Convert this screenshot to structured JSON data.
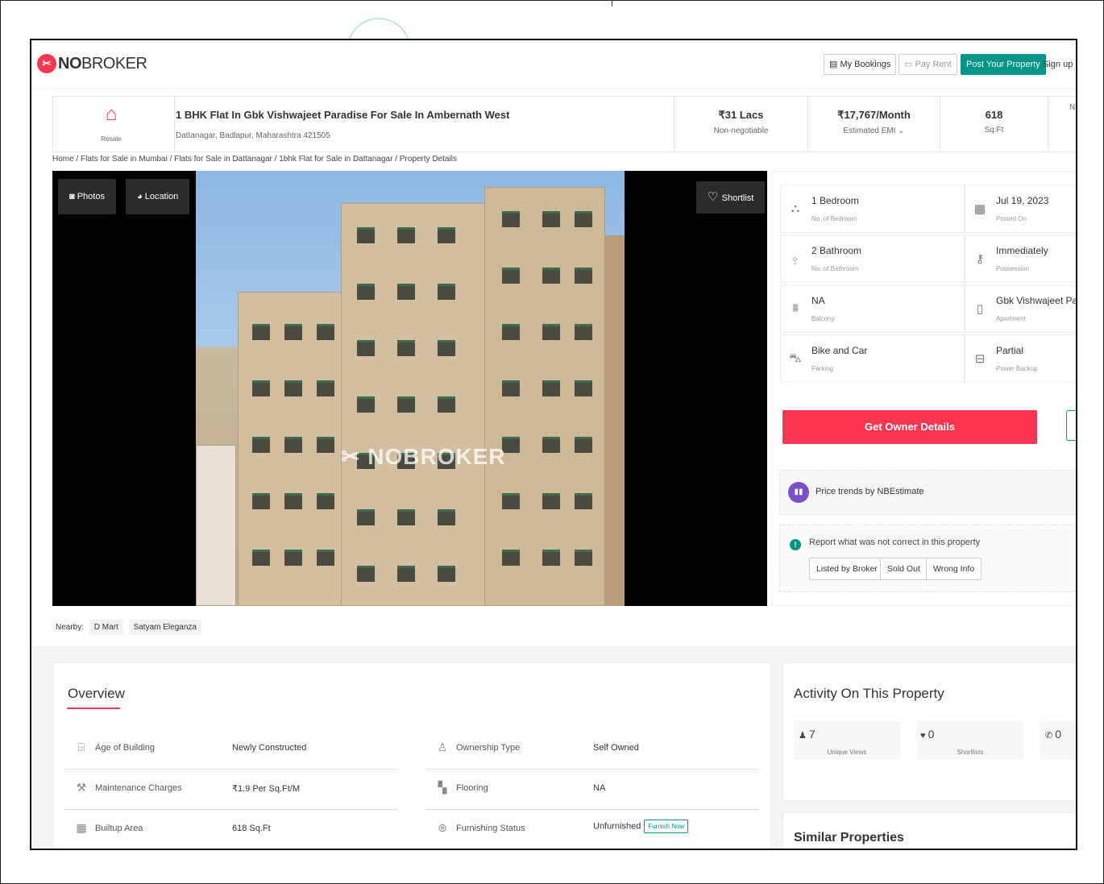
{
  "brand": {
    "logo_text_bold": "NO",
    "logo_text_rest": "BROKER",
    "accent": "#fd3752",
    "green": "#009587"
  },
  "header": {
    "my_bookings": "My Bookings",
    "pay_rent": "Pay Rent",
    "post_property": "Post Your Property",
    "sign_up": "Sign up"
  },
  "listing": {
    "badge": "Resale",
    "title": "1 BHK Flat In Gbk Vishwajeet Paradise For Sale In Ambernath West",
    "address": "Dattanagar, Badlapur, Maharashtra 421505",
    "price": "₹31 Lacs",
    "price_note": "Non-negotiable",
    "emi": "₹17,767/Month",
    "emi_note": "Estimated EMI",
    "area": "618",
    "area_unit": "Sq.Ft",
    "cut_letter": "N"
  },
  "breadcrumb": "Home / Flats for Sale in Mumbai / Flats for Sale in Dattanagar / 1bhk Flat for Sale in Dattanagar / Property Details",
  "photo": {
    "photos_label": "Photos",
    "location_label": "Location",
    "shortlist_label": "Shortlist",
    "watermark": "NOBROKER"
  },
  "nearby": {
    "label": "Nearby:",
    "items": [
      "D Mart",
      "Satyam Eleganza"
    ]
  },
  "details": [
    {
      "value": "1 Bedroom",
      "label": "No. of Bedroom",
      "icon": "bed-icon"
    },
    {
      "value": "Jul 19, 2023",
      "label": "Posted On",
      "icon": "calendar-icon"
    },
    {
      "value": "2 Bathroom",
      "label": "No. of Bathroom",
      "icon": "bath-icon"
    },
    {
      "value": "Immediately",
      "label": "Possession",
      "icon": "key-icon"
    },
    {
      "value": "NA",
      "label": "Balcony",
      "icon": "balcony-icon"
    },
    {
      "value": "Gbk Vishwajeet Par...",
      "label": "Apartment",
      "icon": "building-icon"
    },
    {
      "value": "Bike and Car",
      "label": "Parking",
      "icon": "car-icon"
    },
    {
      "value": "Partial",
      "label": "Power Backup",
      "icon": "battery-icon"
    }
  ],
  "actions": {
    "get_owner": "Get Owner Details",
    "price_trends": "Price trends by NBEstimate",
    "report_text": "Report what was not correct in this property",
    "report_buttons": [
      "Listed by Broker",
      "Sold Out",
      "Wrong Info"
    ]
  },
  "overview": {
    "title": "Overview",
    "rows": [
      {
        "label": "Age of Building",
        "value": "Newly Constructed",
        "icon": "building-age-icon"
      },
      {
        "label": "Ownership Type",
        "value": "Self Owned",
        "icon": "ownership-icon"
      },
      {
        "label": "Maintenance Charges",
        "value": "₹1.9 Per Sq.Ft/M",
        "icon": "maintenance-icon"
      },
      {
        "label": "Flooring",
        "value": "NA",
        "icon": "flooring-icon"
      },
      {
        "label": "Builtup Area",
        "value": "618 Sq.Ft",
        "icon": "area-icon"
      },
      {
        "label": "Furnishing Status",
        "value": "Unfurnished",
        "icon": "sofa-icon"
      }
    ],
    "furnish_now": "Furnish Now"
  },
  "activity": {
    "title": "Activity On This Property",
    "cards": [
      {
        "value": "7",
        "label": "Unique Views",
        "icon": "person-icon"
      },
      {
        "value": "0",
        "label": "Shortlists",
        "icon": "heart-icon"
      },
      {
        "value": "0",
        "label": "",
        "icon": "phone-icon"
      }
    ]
  },
  "similar": {
    "title": "Similar Properties"
  }
}
